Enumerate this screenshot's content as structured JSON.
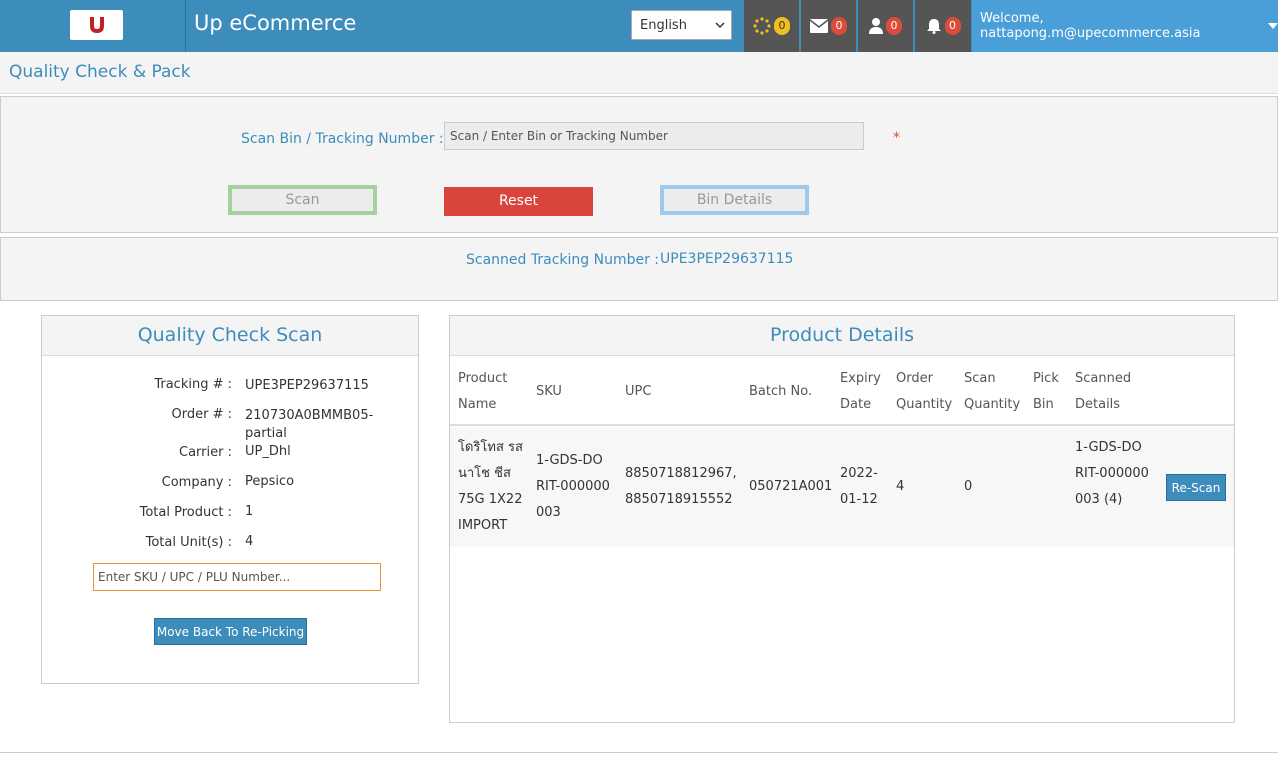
{
  "header": {
    "app_title": "Up eCommerce",
    "logo_letter": "U",
    "language": "English",
    "badges": [
      {
        "icon": "spinner-icon",
        "count": "0"
      },
      {
        "icon": "envelope-icon",
        "count": "0"
      },
      {
        "icon": "user-icon",
        "count": "0"
      },
      {
        "icon": "bell-icon",
        "count": "0"
      }
    ],
    "welcome": "Welcome, nattapong.m@upecommerce.asia",
    "colors": {
      "bar": "#3c8dbc",
      "nav": "#555555",
      "badge_red": "#dd4b39",
      "badge_yellow": "#f0c020"
    }
  },
  "page": {
    "title": "Quality Check & Pack"
  },
  "scan": {
    "label": "Scan Bin / Tracking Number :",
    "placeholder": "Scan / Enter Bin or Tracking Number",
    "required_mark": "*",
    "scan_button": "Scan",
    "reset_button": "Reset",
    "bin_details_button": "Bin Details"
  },
  "scanned": {
    "label": "Scanned Tracking Number :",
    "value": "UPE3PEP29637115"
  },
  "qc": {
    "title": "Quality Check Scan",
    "fields": [
      {
        "label": "Tracking # :",
        "value": "UPE3PEP29637115"
      },
      {
        "label": "Order # :",
        "value": "210730A0BMMB05-partial"
      },
      {
        "label": "Carrier :",
        "value": "UP_Dhl"
      },
      {
        "label": "Company :",
        "value": "Pepsico"
      },
      {
        "label": "Total Product :",
        "value": "1"
      },
      {
        "label": "Total Unit(s) :",
        "value": "4"
      }
    ],
    "sku_placeholder": "Enter SKU / UPC / PLU Number...",
    "repick_button": "Move Back To Re-Picking"
  },
  "product_details": {
    "title": "Product Details",
    "columns": [
      "Product Name",
      "SKU",
      "UPC",
      "Batch No.",
      "Expiry Date",
      "Order Quantity",
      "Scan Quantity",
      "Pick Bin",
      "Scanned Details"
    ],
    "rows": [
      {
        "product_name": "โดริโทส รสนาโช ชีส 75G 1X22 IMPORT",
        "sku": "1-GDS-DORIT-000000003",
        "upc": "8850718812967, 8850718915552",
        "batch_no": "050721A001",
        "expiry_date": "2022-01-12",
        "order_quantity": "4",
        "scan_quantity": "0",
        "pick_bin": "",
        "scanned_details": "1-GDS-DORIT-000000003 (4)",
        "action": "Re-Scan"
      }
    ]
  }
}
